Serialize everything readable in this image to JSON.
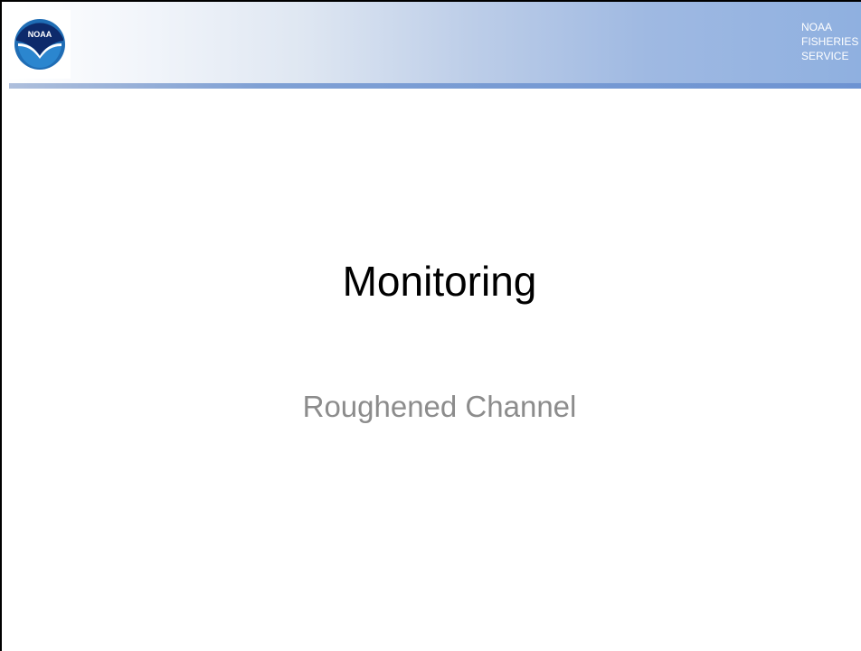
{
  "header": {
    "logo_text": "NOAA",
    "agency_lines": [
      "NOAA",
      "FISHERIES",
      "SERVICE"
    ]
  },
  "slide": {
    "title": "Monitoring",
    "subtitle": "Roughened Channel"
  },
  "colors": {
    "header_gradient_end": "#8fb0e0",
    "header_bar": "#6d93d2",
    "title_text": "#000000",
    "subtitle_text": "#8c8c8c",
    "logo_blue": "#1f6db5"
  }
}
